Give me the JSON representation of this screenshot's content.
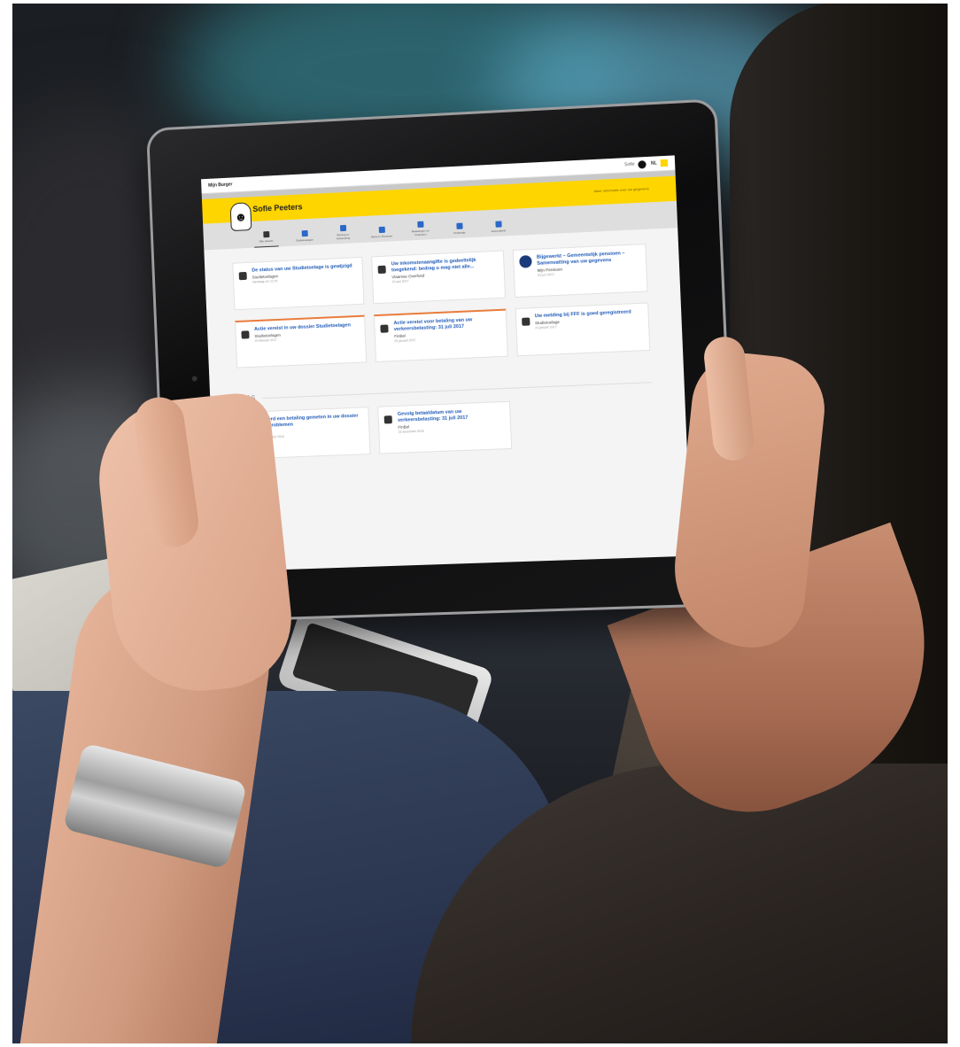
{
  "scene": {
    "description_tags": [
      "tablet-photo"
    ],
    "colors": {
      "accent": "#ffd500",
      "link": "#1e5ab8",
      "alert": "#e97c3c"
    }
  },
  "os_bar": {
    "title": "Mijn Burger",
    "user": "Sofie",
    "lang": "NL"
  },
  "hero": {
    "name": "Sofie Peeters",
    "link": "Meer informatie over uw gegevens"
  },
  "nav": [
    {
      "label": "Mijn dossier",
      "icon": "person-icon",
      "active": true
    },
    {
      "label": "Studietoelagen",
      "icon": "car-icon",
      "active": false
    },
    {
      "label": "Woning en Huisvesting",
      "icon": "house-icon",
      "active": false
    },
    {
      "label": "Werk en Pensioen",
      "icon": "briefcase-icon",
      "active": false
    },
    {
      "label": "Belastingen en Financien",
      "icon": "document-icon",
      "active": false
    },
    {
      "label": "Onderwijs",
      "icon": "graduation-icon",
      "active": false
    },
    {
      "label": "Gezondheid",
      "icon": "health-icon",
      "active": false
    }
  ],
  "cards": [
    {
      "title": "De status van uw Studietoelage is gewijzigd",
      "sub": "Studietoelagen",
      "date": "Vandaag om 11:00",
      "alert": false,
      "icon": "tray-icon"
    },
    {
      "title": "Uw inkomstenaangifte is gedeeltelijk toegekend: bedrag u mag niet alle...",
      "sub": "Vlaamse Overheid",
      "date": "22 juni 2017",
      "alert": false,
      "icon": "tray-icon"
    },
    {
      "title": "Bijgewerkt – Gemeentelijk pensioen – Samenvatting van uw gegevens",
      "sub": "Mijn Pensioen",
      "date": "20 juni 2017",
      "alert": false,
      "icon": "round-logo-icon"
    },
    {
      "title": "Actie vereist in uw dossier Studietoelagen",
      "sub": "Studietoelagen",
      "date": "20 februari 2017",
      "alert": true,
      "icon": "tray-icon"
    },
    {
      "title": "Actie vereist voor betaling van uw verkeersbelasting: 31 juli 2017",
      "sub": "FinBel",
      "date": "23 januari 2017",
      "alert": true,
      "icon": "doc-icon"
    },
    {
      "title": "Uw melding bij FFF is goed geregistreerd",
      "sub": "Studietoelage",
      "date": "21 januari 2017",
      "alert": false,
      "icon": "bell-icon"
    }
  ],
  "section2": {
    "year": "2016",
    "cards": [
      {
        "title": "Er werd een betaling gemeten in uw dossier Huisproblemen",
        "sub": "Apple",
        "date": "23 december 2016",
        "icon": "bell-icon"
      },
      {
        "title": "Gevolg betaaldatum van uw verkeersbelasting: 31 juli 2017",
        "sub": "FinBel",
        "date": "23 december 2016",
        "icon": "doc-icon"
      }
    ]
  }
}
